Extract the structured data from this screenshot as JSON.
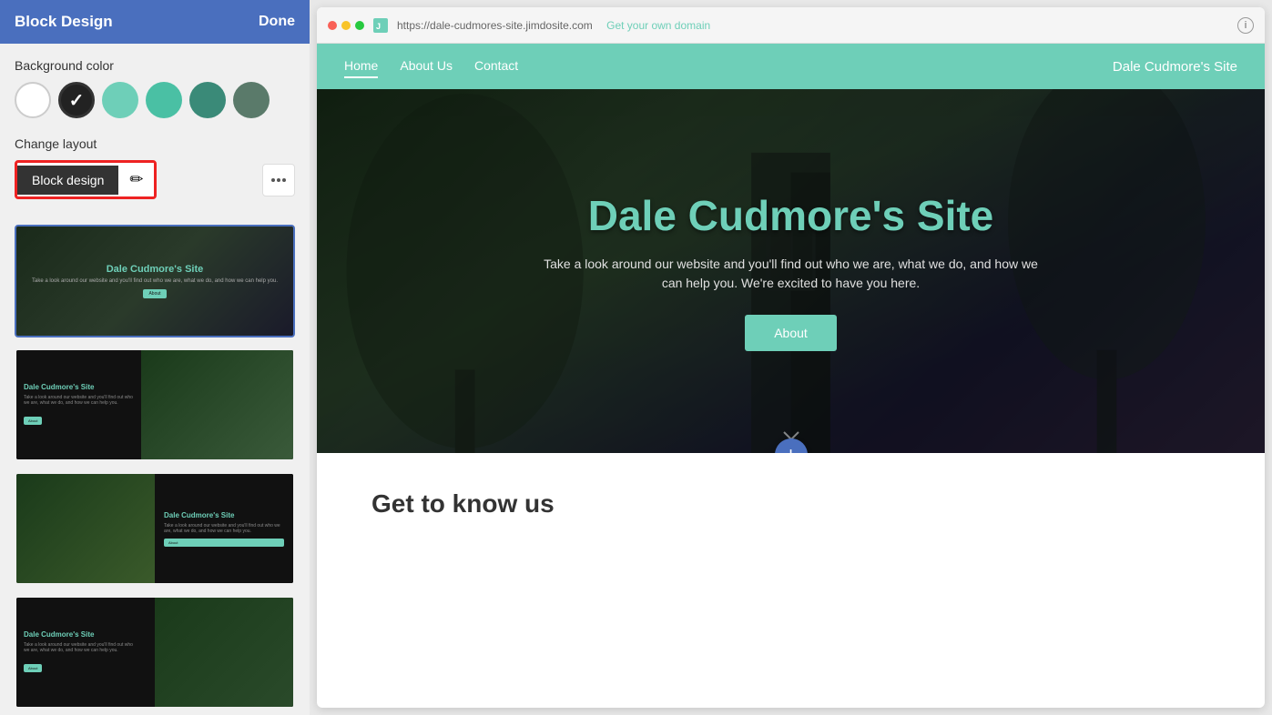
{
  "panel": {
    "title": "Block Design",
    "done_label": "Done",
    "bg_color_label": "Background color",
    "change_layout_label": "Change layout",
    "colors": [
      {
        "id": "white",
        "hex": "#ffffff",
        "selected": false
      },
      {
        "id": "dark",
        "hex": "#222222",
        "selected": true
      },
      {
        "id": "teal-light",
        "hex": "#6ecfb8",
        "selected": false
      },
      {
        "id": "teal-medium",
        "hex": "#4ac0a4",
        "selected": false
      },
      {
        "id": "teal-dark",
        "hex": "#3a8a78",
        "selected": false
      },
      {
        "id": "gray",
        "hex": "#5a7a6a",
        "selected": false
      }
    ],
    "block_design_btn_label": "Block design",
    "more_options_label": "⋮",
    "layouts": [
      {
        "id": "layout1",
        "active": true,
        "label": "Layout 1 - full width dark"
      },
      {
        "id": "layout2",
        "active": false,
        "label": "Layout 2 - dark left, image right"
      },
      {
        "id": "layout3",
        "active": false,
        "label": "Layout 3 - image left, content right"
      },
      {
        "id": "layout4",
        "active": false,
        "label": "Layout 4 - dark left image right variant"
      }
    ]
  },
  "browser": {
    "url_prefix": "https://",
    "url_domain": "dale-cudmores-site.jimdosite.com",
    "url_cta": "Get your own domain",
    "info_icon": "i"
  },
  "site": {
    "nav": {
      "home": "Home",
      "about_us": "About Us",
      "contact": "Contact",
      "site_title": "Dale Cudmore's Site"
    },
    "hero": {
      "title": "Dale Cudmore's Site",
      "subtitle": "Take a look around our website and you'll find out who we are, what we do, and how we can help you. We're excited to have you here.",
      "button_label": "About"
    },
    "below_hero": {
      "title": "Get to know us"
    }
  }
}
